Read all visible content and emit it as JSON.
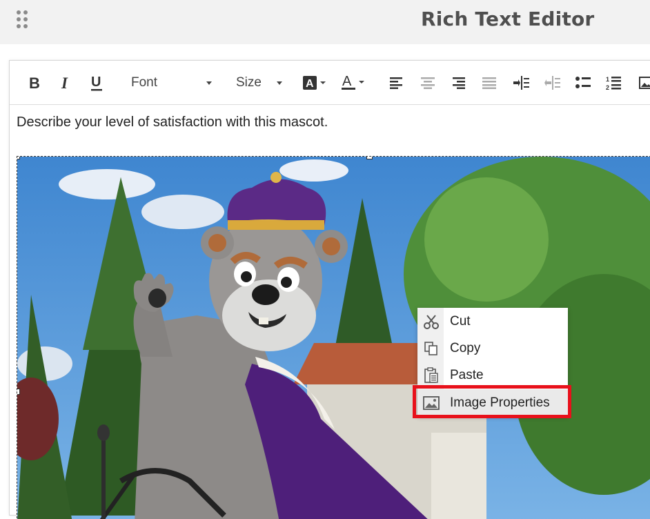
{
  "app": {
    "title": "Rich Text Editor"
  },
  "toolbar": {
    "font_label": "Font",
    "size_label": "Size"
  },
  "editor": {
    "prompt": "Describe your level of satisfaction with this mascot."
  },
  "context_menu": {
    "items": [
      {
        "label": "Cut",
        "icon": "scissors-icon"
      },
      {
        "label": "Copy",
        "icon": "copy-icon"
      },
      {
        "label": "Paste",
        "icon": "paste-icon"
      },
      {
        "label": "Image Properties",
        "icon": "image-icon"
      }
    ]
  },
  "colors": {
    "highlight": "#e8111b",
    "crown_purple": "#5b2a86",
    "sky": "#4a8fd4"
  }
}
